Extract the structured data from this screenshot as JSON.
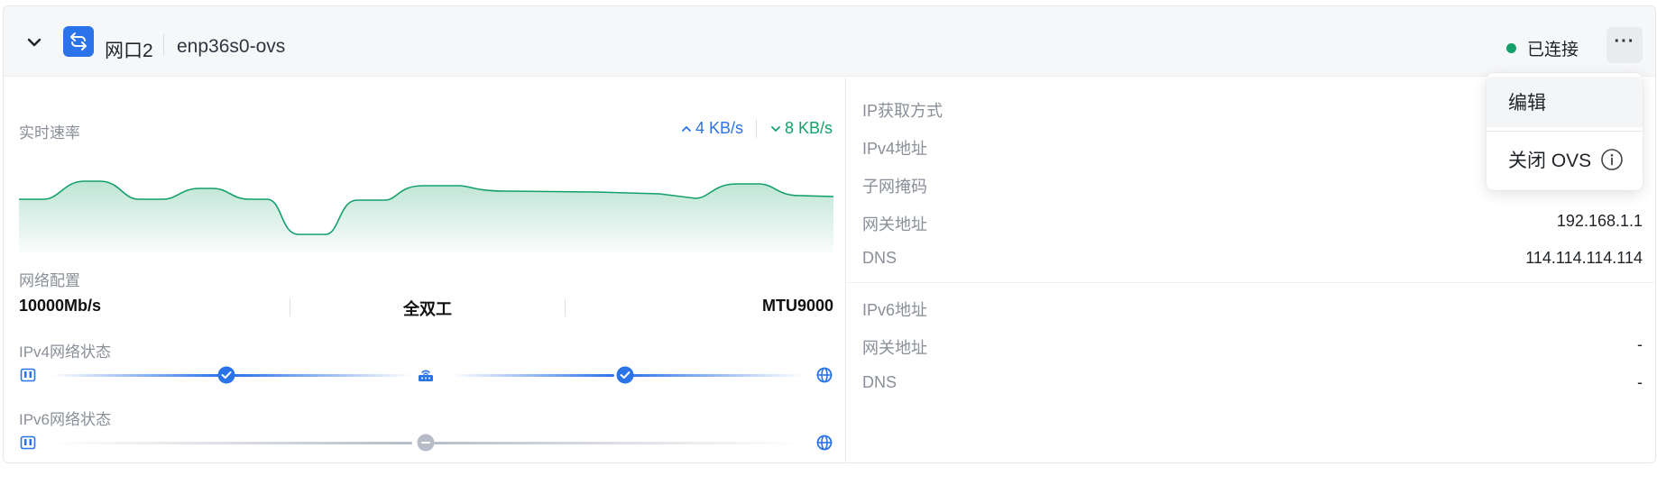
{
  "header": {
    "port_name": "网口2",
    "iface_name": "enp36s0-ovs",
    "status_text": "已连接",
    "status_color": "#14a06a",
    "more_label": "···"
  },
  "left": {
    "rate_label": "实时速率",
    "upload_speed": "4 KB/s",
    "download_speed": "8 KB/s",
    "netcfg_label": "网络配置",
    "link_speed": "10000Mb/s",
    "duplex": "全双工",
    "mtu": "MTU9000",
    "ipv4_status_label": "IPv4网络状态",
    "ipv6_status_label": "IPv6网络状态",
    "ipv4_status": {
      "port_to_router": "ok",
      "router_to_internet": "ok"
    },
    "ipv6_status": {
      "overall": "disabled"
    }
  },
  "right": {
    "ipv4": [
      {
        "key": "IP获取方式",
        "value": ""
      },
      {
        "key": "IPv4地址",
        "value": ""
      },
      {
        "key": "子网掩码",
        "value": ""
      },
      {
        "key": "网关地址",
        "value": "192.168.1.1"
      },
      {
        "key": "DNS",
        "value": "114.114.114.114"
      }
    ],
    "ipv6": [
      {
        "key": "IPv6地址",
        "value": ""
      },
      {
        "key": "网关地址",
        "value": "-"
      },
      {
        "key": "DNS",
        "value": "-"
      }
    ]
  },
  "menu": {
    "edit": "编辑",
    "close_ovs": "关闭 OVS"
  },
  "colors": {
    "accent": "#2a73e8",
    "success": "#14a06a",
    "disabled": "#b6bcc8"
  }
}
